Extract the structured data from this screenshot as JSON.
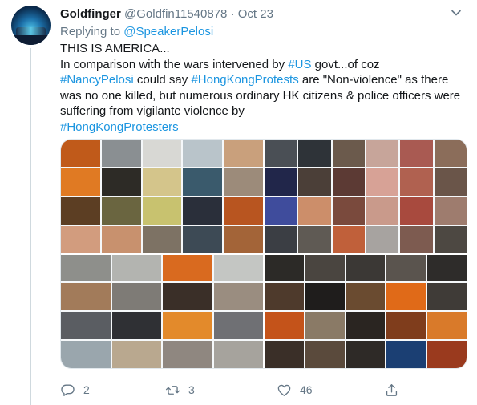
{
  "tweet": {
    "display_name": "Goldfinger",
    "handle": "@Goldfin11540878",
    "separator": "·",
    "date": "Oct 23",
    "replying_prefix": "Replying to ",
    "replying_to": "@SpeakerPelosi",
    "lines": {
      "l1": "THIS IS AMERICA...",
      "l2_a": "In comparison with the wars intervened by ",
      "l2_tag": "#US",
      "l2_b": " govt...of coz",
      "l3_tag": "#NancyPelosi",
      "l3_a": " could say ",
      "l3_tag2": "#HongKongProtests",
      "l3_b": " are \"Non-violence\" as there was no one killed, but numerous ordinary HK citizens & police officers were suffering from vigilante violence by ",
      "l4_tag": "#HongKongProtesters"
    },
    "media_alt": "Collage of Hong Kong protest photos",
    "counts": {
      "replies": "2",
      "retweets": "3",
      "likes": "46"
    }
  },
  "icons": {
    "caret": "chevron-down-icon",
    "reply": "reply-icon",
    "retweet": "retweet-icon",
    "like": "heart-icon",
    "share": "share-icon"
  },
  "colors": {
    "link": "#1b95e0",
    "muted": "#657786",
    "text": "#14171a"
  }
}
